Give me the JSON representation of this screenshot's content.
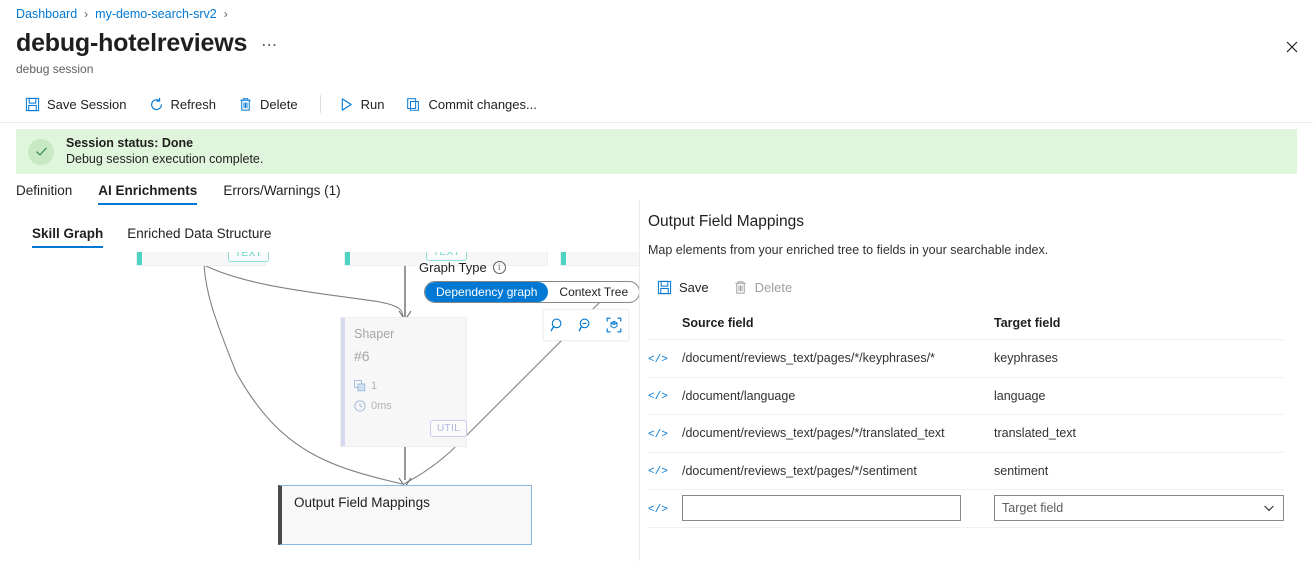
{
  "breadcrumb": {
    "items": [
      {
        "label": "Dashboard"
      },
      {
        "label": "my-demo-search-srv2"
      }
    ],
    "separator": "›"
  },
  "header": {
    "title": "debug-hotelreviews",
    "subtitle": "debug session",
    "ellipsis": "⋯",
    "close_icon": "close-icon"
  },
  "toolbar": {
    "save_session": "Save Session",
    "refresh": "Refresh",
    "delete": "Delete",
    "run": "Run",
    "commit": "Commit changes..."
  },
  "banner": {
    "status_title": "Session status: Done",
    "status_sub": "Debug session execution complete.",
    "background": "#dff6dd",
    "icon": "checkmark-icon"
  },
  "tabs": {
    "items": [
      {
        "label": "Definition",
        "selected": false
      },
      {
        "label": "AI Enrichments",
        "selected": true
      },
      {
        "label": "Errors/Warnings (1)",
        "selected": false
      }
    ]
  },
  "subtabs": {
    "items": [
      {
        "label": "Skill Graph",
        "selected": true
      },
      {
        "label": "Enriched Data Structure",
        "selected": false
      }
    ]
  },
  "graph": {
    "type_label": "Graph Type",
    "type_options": [
      {
        "label": "Dependency graph",
        "active": true
      },
      {
        "label": "Context Tree",
        "active": false
      }
    ],
    "zoom_in_icon": "zoom-in-icon",
    "zoom_out_icon": "zoom-out-icon",
    "fit_icon": "fit-to-screen-icon",
    "nodes": [
      {
        "id": "node-text-1",
        "badge": "TEXT",
        "accent": "#4cd3c2"
      },
      {
        "id": "node-text-2",
        "badge": "TEXT",
        "accent": "#4cd3c2"
      },
      {
        "id": "node-text-3",
        "badge": "",
        "accent": "#4cd3c2"
      }
    ],
    "shaper": {
      "title": "Shaper",
      "number": "#6",
      "documents": "1",
      "duration": "0ms",
      "badge": "UTIL",
      "accent": "#d6d9ee"
    },
    "output_node": {
      "label": "Output Field Mappings"
    }
  },
  "detail": {
    "title": "Output Field Mappings",
    "description": "Map elements from your enriched tree to fields in your searchable index.",
    "save_label": "Save",
    "delete_label": "Delete",
    "columns": {
      "source": "Source field",
      "target": "Target field"
    },
    "rows": [
      {
        "source": "/document/reviews_text/pages/*/keyphrases/*",
        "target": "keyphrases"
      },
      {
        "source": "/document/language",
        "target": "language"
      },
      {
        "source": "/document/reviews_text/pages/*/translated_text",
        "target": "translated_text"
      },
      {
        "source": "/document/reviews_text/pages/*/sentiment",
        "target": "sentiment"
      }
    ],
    "new_row": {
      "source_value": "",
      "source_placeholder": "",
      "target_placeholder": "Target field"
    }
  },
  "colors": {
    "accent_blue": "#0078d4",
    "teal": "#4cd3c2",
    "success_bg": "#dff6dd"
  }
}
